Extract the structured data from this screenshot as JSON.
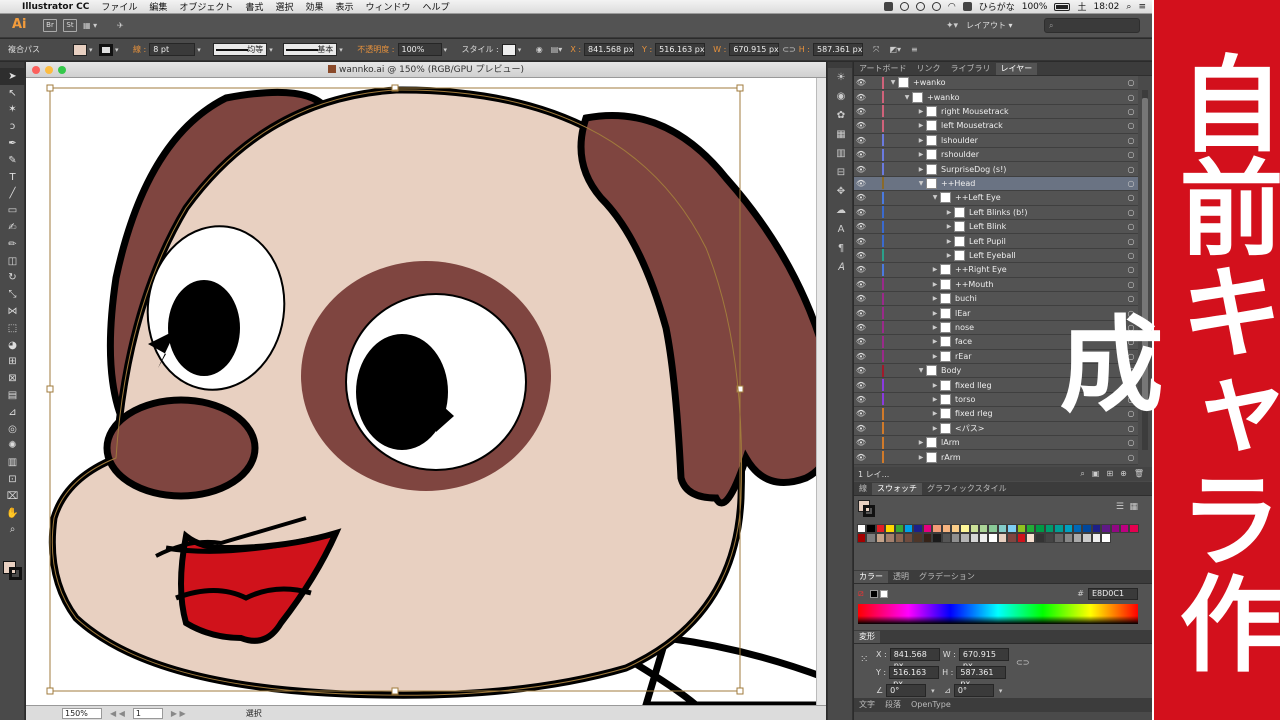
{
  "menubar": {
    "app_name": "Illustrator CC",
    "items": [
      "ファイル",
      "編集",
      "オブジェクト",
      "書式",
      "選択",
      "効果",
      "表示",
      "ウィンドウ",
      "ヘルプ"
    ],
    "input_method": "ひらがな",
    "battery": "100%",
    "day": "土",
    "time": "18:02"
  },
  "appbar": {
    "logo": "Ai",
    "bridge": "Br",
    "stock": "St",
    "workspace": "レイアウト"
  },
  "control": {
    "object_type": "複合パス",
    "stroke_label": "線 :",
    "stroke_weight": "8 pt",
    "profile": "均等",
    "brush": "基本",
    "opacity_label": "不透明度 :",
    "opacity": "100%",
    "style_label": "スタイル :",
    "x_label": "X :",
    "x": "841.568 px",
    "y_label": "Y :",
    "y": "516.163 px",
    "w_label": "W :",
    "w": "670.915 px",
    "h_label": "H :",
    "h": "587.361 px",
    "fill_color": "#e8d0c1"
  },
  "document": {
    "title": "wannko.ai @ 150% (RGB/GPU プレビュー)",
    "zoom": "150%",
    "page": "1",
    "status": "選択"
  },
  "layers_panel": {
    "tabs": [
      "アートボード",
      "リンク",
      "ライブラリ",
      "レイヤー"
    ],
    "active_tab": "レイヤー",
    "rows": [
      {
        "name": "+wanko",
        "indent": 0,
        "expanded": true,
        "color": "#d0627a"
      },
      {
        "name": "+wanko",
        "indent": 1,
        "expanded": true,
        "color": "#d0627a"
      },
      {
        "name": "right Mousetrack",
        "indent": 2,
        "expanded": false,
        "color": "#d0627a"
      },
      {
        "name": "left Mousetrack",
        "indent": 2,
        "expanded": false,
        "color": "#d0627a"
      },
      {
        "name": "lshoulder",
        "indent": 2,
        "expanded": false,
        "color": "#6a7adf"
      },
      {
        "name": "rshoulder",
        "indent": 2,
        "expanded": false,
        "color": "#6a7adf"
      },
      {
        "name": "SurpriseDog (s!)",
        "indent": 2,
        "expanded": false,
        "color": "#6a7adf"
      },
      {
        "name": "++Head",
        "indent": 2,
        "expanded": true,
        "color": "#8a6a2a",
        "selected": true
      },
      {
        "name": "++Left Eye",
        "indent": 3,
        "expanded": true,
        "color": "#4a7adf"
      },
      {
        "name": "Left Blinks (b!)",
        "indent": 4,
        "expanded": false,
        "color": "#3a6acf"
      },
      {
        "name": "Left Blink",
        "indent": 4,
        "expanded": false,
        "color": "#3a6acf"
      },
      {
        "name": "Left Pupil",
        "indent": 4,
        "expanded": false,
        "color": "#3a6acf"
      },
      {
        "name": "Left Eyeball",
        "indent": 4,
        "expanded": false,
        "color": "#2aa08a"
      },
      {
        "name": "++Right Eye",
        "indent": 3,
        "expanded": false,
        "color": "#4a7adf"
      },
      {
        "name": "++Mouth",
        "indent": 3,
        "expanded": false,
        "color": "#9a2a8a"
      },
      {
        "name": "buchi",
        "indent": 3,
        "expanded": false,
        "color": "#9a2a8a"
      },
      {
        "name": "lEar",
        "indent": 3,
        "expanded": false,
        "color": "#9a2a8a"
      },
      {
        "name": "nose",
        "indent": 3,
        "expanded": false,
        "color": "#9a2a8a"
      },
      {
        "name": "face",
        "indent": 3,
        "expanded": false,
        "color": "#9a2a8a"
      },
      {
        "name": "rEar",
        "indent": 3,
        "expanded": false,
        "color": "#9a2a8a"
      },
      {
        "name": "Body",
        "indent": 2,
        "expanded": true,
        "color": "#a01a2a"
      },
      {
        "name": "fixed lleg",
        "indent": 3,
        "expanded": false,
        "color": "#8a3adf"
      },
      {
        "name": "torso",
        "indent": 3,
        "expanded": false,
        "color": "#8a3adf"
      },
      {
        "name": "fixed rleg",
        "indent": 3,
        "expanded": false,
        "color": "#d07a2a"
      },
      {
        "name": "<パス>",
        "indent": 3,
        "expanded": false,
        "color": "#d07a2a"
      },
      {
        "name": "lArm",
        "indent": 2,
        "expanded": false,
        "color": "#d07a2a"
      },
      {
        "name": "rArm",
        "indent": 2,
        "expanded": false,
        "color": "#d07a2a"
      }
    ],
    "footer": "1 レイ..."
  },
  "swatches_panel": {
    "tabs": [
      "線",
      "スウォッチ",
      "グラフィックスタイル"
    ],
    "active_tab": "スウォッチ",
    "colors": [
      "#ffffff",
      "#000000",
      "#e31e24",
      "#ffd700",
      "#3aa935",
      "#00a0e9",
      "#1d2088",
      "#e4007f",
      "#f29b76",
      "#f6b37f",
      "#facd89",
      "#fff799",
      "#cce198",
      "#acd598",
      "#89c997",
      "#84ccc9",
      "#7ecef4",
      "#8fc31f",
      "#22ac38",
      "#009944",
      "#009b6b",
      "#009e96",
      "#00a0c1",
      "#0068b7",
      "#00479d",
      "#1d2088",
      "#601986",
      "#920783",
      "#be0081",
      "#e5004f",
      "#a40000",
      "#7d7d7d",
      "#c5a38a",
      "#a4806c",
      "#8b6551",
      "#6f4b3e",
      "#4e3629",
      "#362318",
      "#1b1b1b",
      "#555555",
      "#8f8f8f",
      "#b5b5b5",
      "#d6d6d6",
      "#ededed",
      "#ffffff",
      "#e8d0c1",
      "#7f4540",
      "#d0121b",
      "#f8e0d0",
      "#333333",
      "#444444",
      "#666666",
      "#888888",
      "#aaaaaa",
      "#cccccc",
      "#eeeeee",
      "#ffffff"
    ]
  },
  "color_panel": {
    "tabs": [
      "カラー",
      "透明",
      "グラデーション"
    ],
    "hex_label": "#",
    "hex": "E8D0C1"
  },
  "transform_panel": {
    "title": "変形",
    "x_label": "X :",
    "x": "841.568 px",
    "y_label": "Y :",
    "y": "516.163 px",
    "w_label": "W :",
    "w": "670.915 px",
    "h_label": "H :",
    "h": "587.361 px",
    "angle": "0°",
    "shear": "0°"
  },
  "bottom_tabs": [
    "文字",
    "段落",
    "OpenType"
  ],
  "banner": {
    "text": "自前キャラ作成"
  }
}
